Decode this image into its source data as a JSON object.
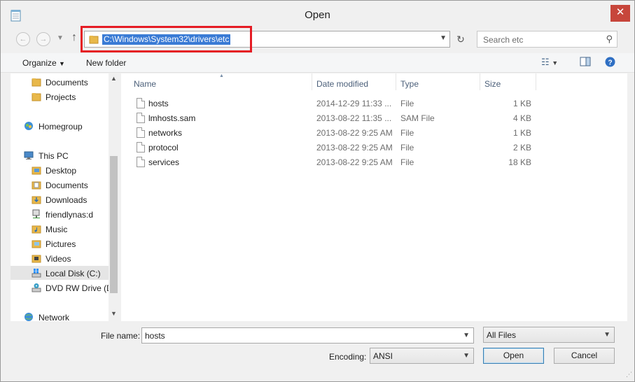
{
  "window": {
    "title": "Open"
  },
  "address": {
    "path": "C:\\Windows\\System32\\drivers\\etc"
  },
  "search": {
    "placeholder": "Search etc"
  },
  "toolbar": {
    "organize": "Organize",
    "new_folder": "New folder"
  },
  "sidebar": {
    "items": [
      {
        "label": "Documents",
        "icon": "folder-icon"
      },
      {
        "label": "Projects",
        "icon": "folder-icon"
      },
      {
        "label": "Homegroup",
        "icon": "homegroup-icon"
      },
      {
        "label": "This PC",
        "icon": "computer-icon"
      },
      {
        "label": "Desktop",
        "icon": "folder-icon"
      },
      {
        "label": "Documents",
        "icon": "folder-icon"
      },
      {
        "label": "Downloads",
        "icon": "folder-icon"
      },
      {
        "label": "friendlynas:d",
        "icon": "network-drive-icon"
      },
      {
        "label": "Music",
        "icon": "folder-icon"
      },
      {
        "label": "Pictures",
        "icon": "folder-icon"
      },
      {
        "label": "Videos",
        "icon": "folder-icon"
      },
      {
        "label": "Local Disk (C:)",
        "icon": "drive-icon"
      },
      {
        "label": "DVD RW Drive (D",
        "icon": "dvd-icon"
      },
      {
        "label": "Network",
        "icon": "network-icon"
      }
    ],
    "selected": "Local Disk (C:)"
  },
  "columns": {
    "name": "Name",
    "date": "Date modified",
    "type": "Type",
    "size": "Size"
  },
  "files": [
    {
      "name": "hosts",
      "date": "2014-12-29 11:33 ...",
      "type": "File",
      "size": "1 KB"
    },
    {
      "name": "lmhosts.sam",
      "date": "2013-08-22 11:35 ...",
      "type": "SAM File",
      "size": "4 KB"
    },
    {
      "name": "networks",
      "date": "2013-08-22 9:25 AM",
      "type": "File",
      "size": "1 KB"
    },
    {
      "name": "protocol",
      "date": "2013-08-22 9:25 AM",
      "type": "File",
      "size": "2 KB"
    },
    {
      "name": "services",
      "date": "2013-08-22 9:25 AM",
      "type": "File",
      "size": "18 KB"
    }
  ],
  "bottom": {
    "file_name_label": "File name:",
    "file_name_value": "hosts",
    "filter_value": "All Files",
    "encoding_label": "Encoding:",
    "encoding_value": "ANSI",
    "open_label": "Open",
    "cancel_label": "Cancel"
  },
  "colors": {
    "highlight_box": "#e51c24",
    "selection": "#3a7bd5",
    "close_button": "#c7463b"
  }
}
